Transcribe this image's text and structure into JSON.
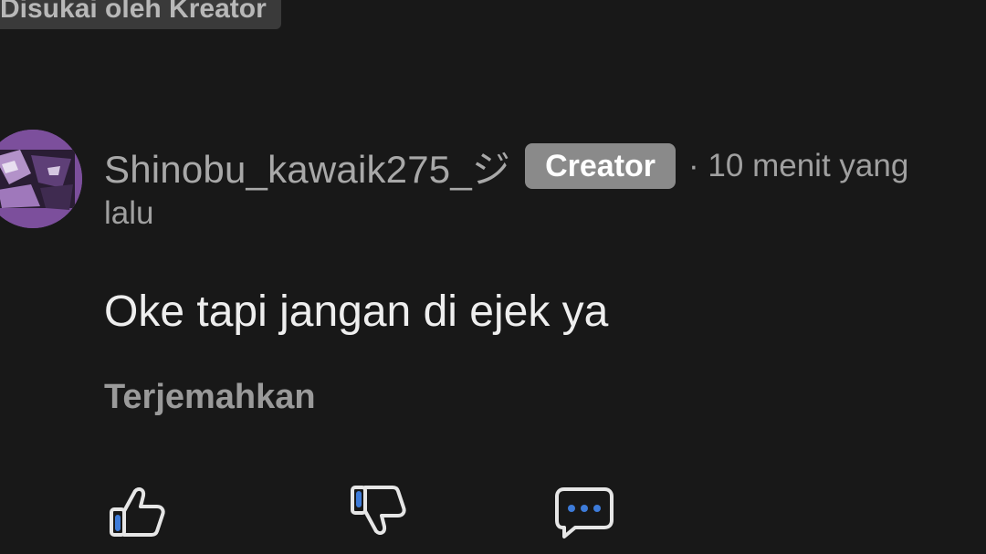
{
  "banner": {
    "liked_by_creator": "Disukai oleh Kreator"
  },
  "comment": {
    "username": "Shinobu_kawaik275_ジ",
    "badge": "Creator",
    "time_part1": "· 10 menit yang",
    "time_part2": "lalu",
    "text": "Oke tapi jangan di ejek ya",
    "translate_label": "Terjemahkan"
  },
  "icons": {
    "like": "thumbs-up-icon",
    "dislike": "thumbs-down-icon",
    "reply": "comment-bubble-icon"
  },
  "colors": {
    "background": "#181818",
    "badge": "#8a8a8a",
    "avatar": "#7c4f9c",
    "icon_accent": "#3d7bd9"
  }
}
